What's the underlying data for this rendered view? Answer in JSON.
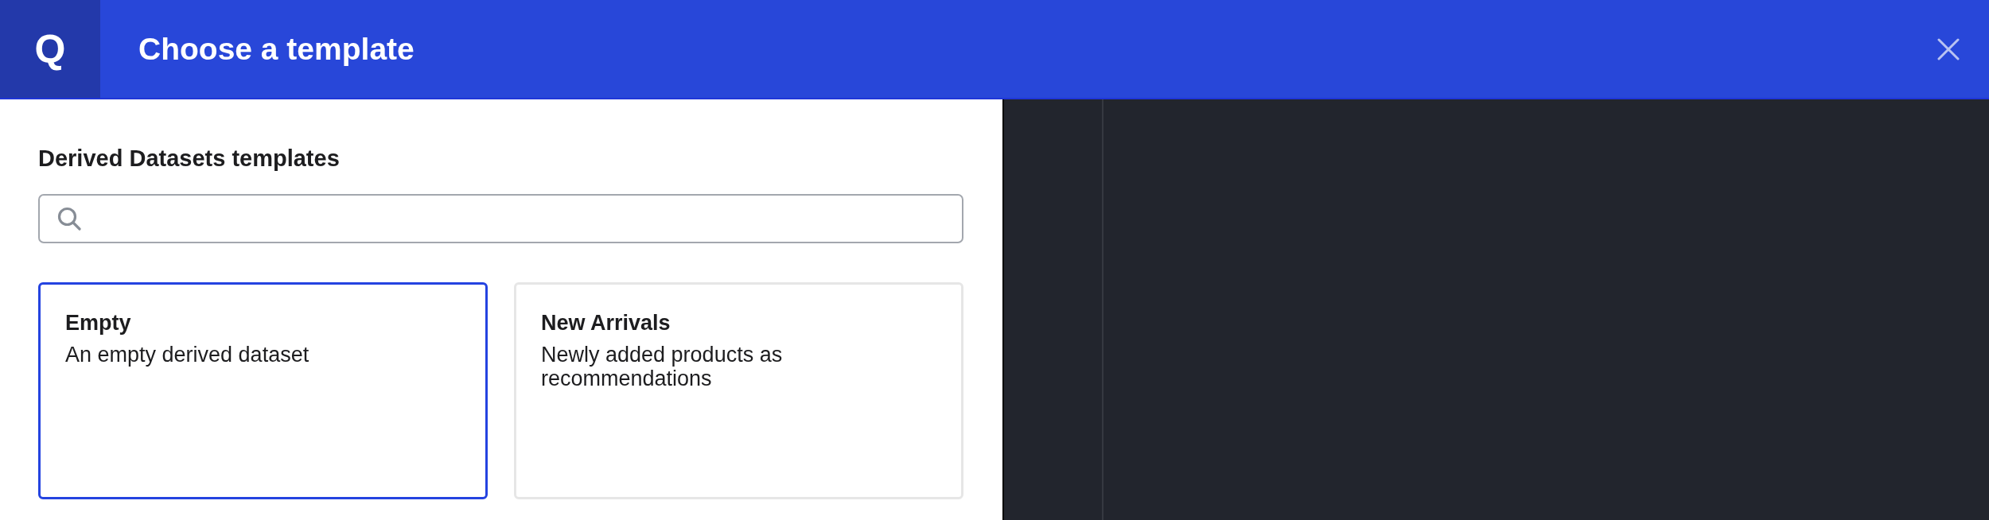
{
  "header": {
    "logo": "Q",
    "title": "Choose a template"
  },
  "panel": {
    "heading": "Derived Datasets templates"
  },
  "templates": [
    {
      "title": "Empty",
      "description": "An empty derived dataset",
      "selected": true
    },
    {
      "title": "New Arrivals",
      "description": "Newly added products as recommendations",
      "selected": false
    }
  ]
}
